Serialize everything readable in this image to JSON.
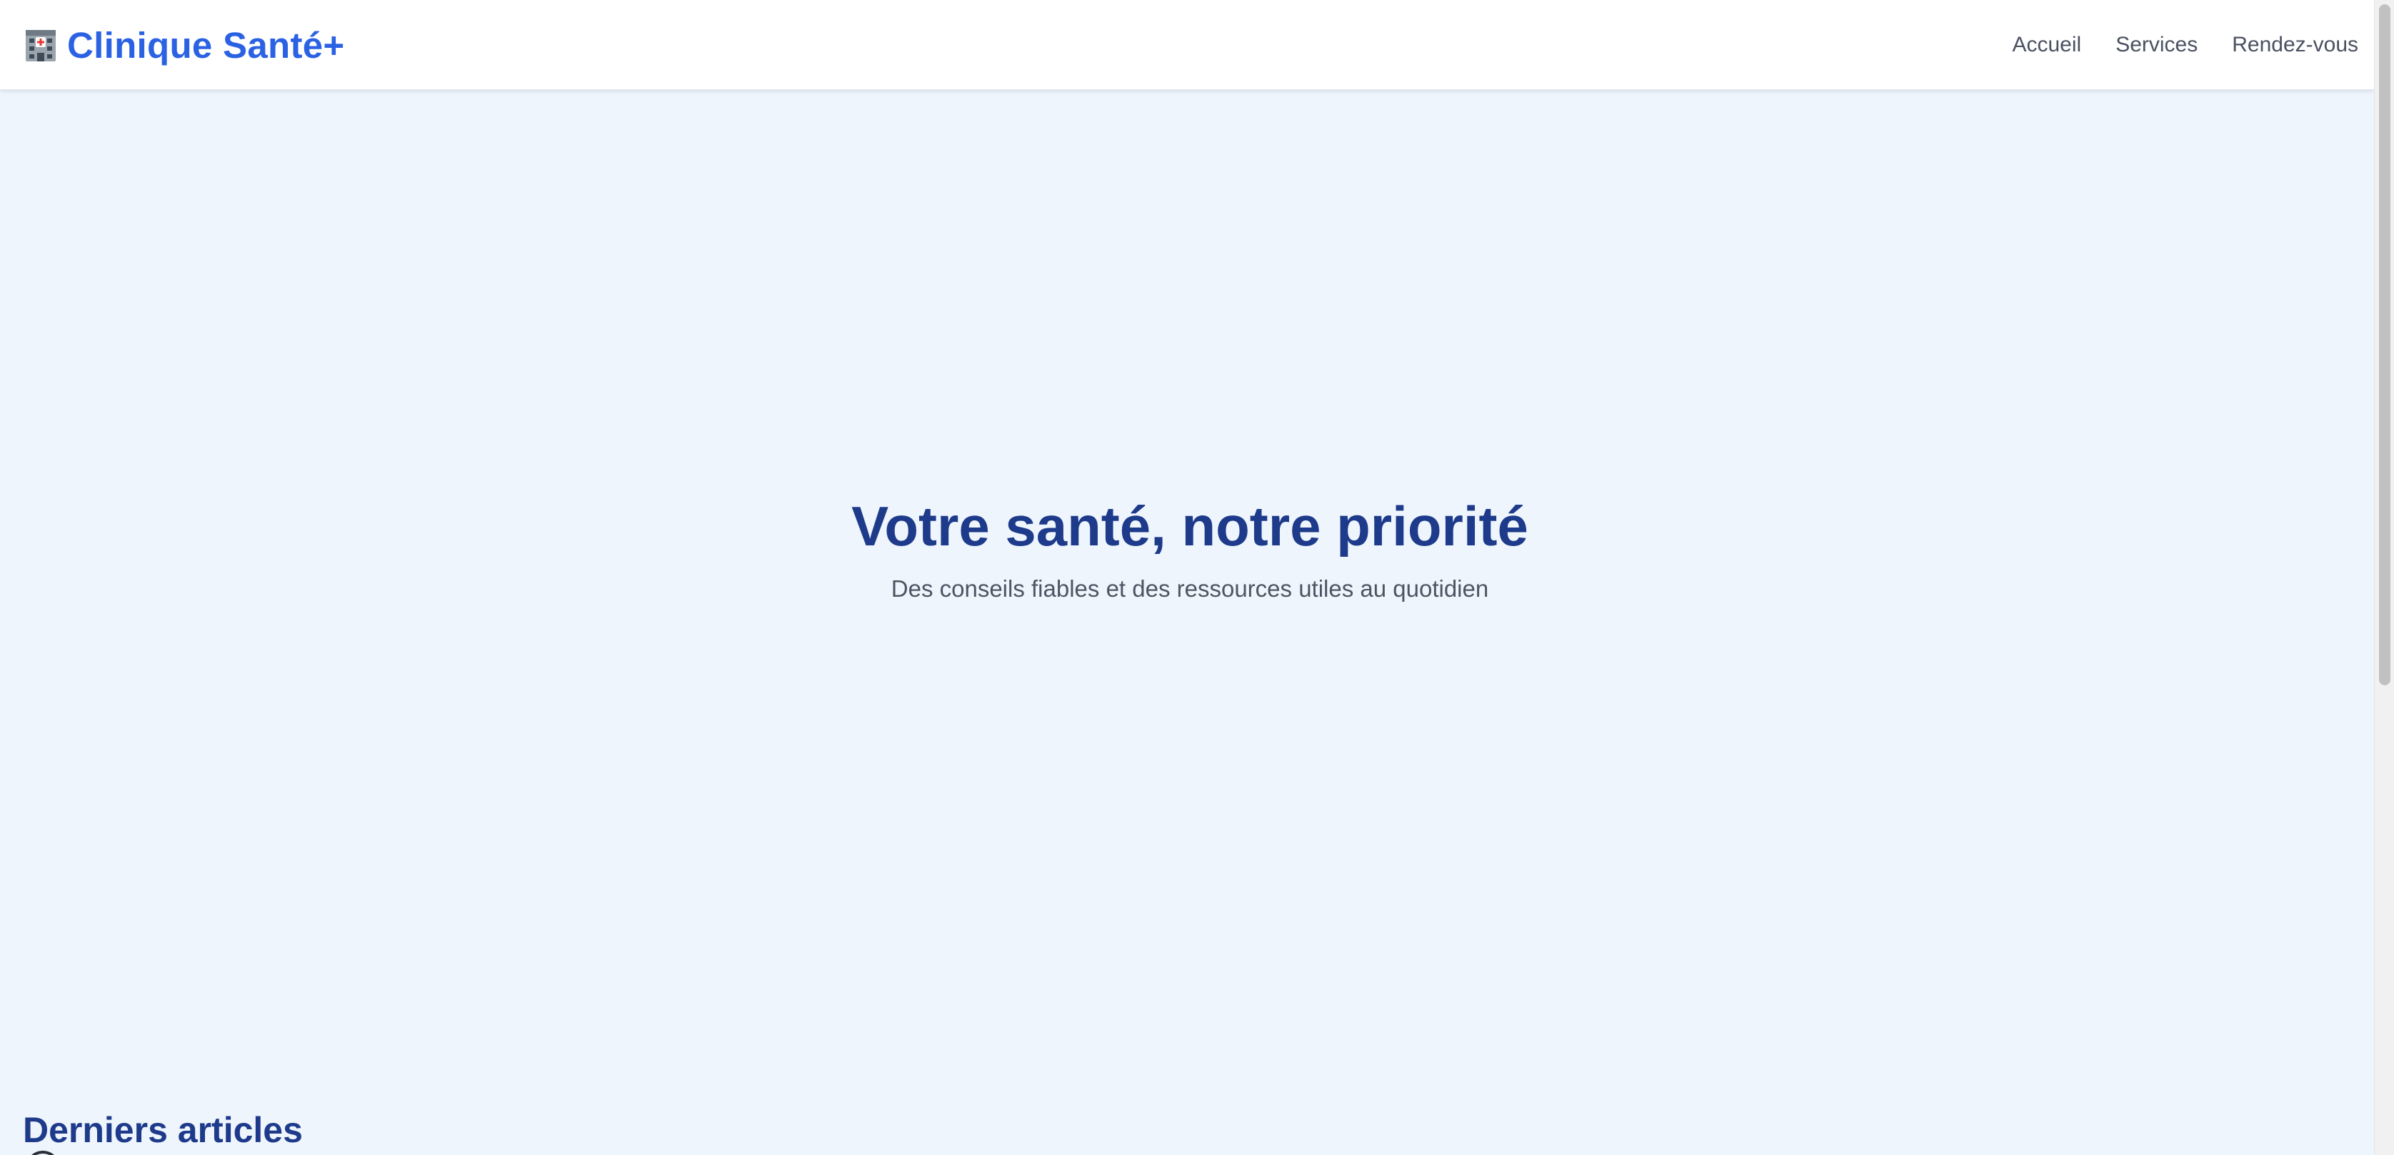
{
  "header": {
    "brand_icon": "hospital-icon",
    "brand_name": "Clinique Santé+",
    "nav": {
      "home": "Accueil",
      "services": "Services",
      "appointments": "Rendez-vous"
    }
  },
  "hero": {
    "title": "Votre santé, notre priorité",
    "subtitle": "Des conseils fiables et des ressources utiles au quotidien"
  },
  "articles": {
    "heading": "Derniers articles"
  },
  "colors": {
    "brand": "#2b62e3",
    "heading": "#1e3a8a",
    "page_background": "#eef5fd",
    "header_background": "#ffffff",
    "nav_text": "#4a5160"
  }
}
